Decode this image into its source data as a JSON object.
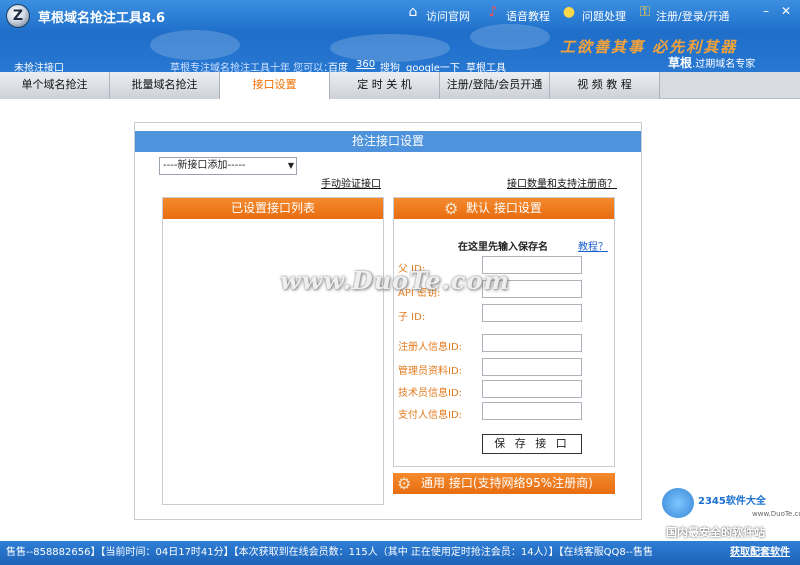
{
  "header": {
    "logo_glyph": "Z",
    "app_title": "草根域名抢注工具8.6",
    "links": {
      "visit_site": "访问官网",
      "voice_tutorial": "语音教程",
      "issue_handling": "问题处理",
      "register_login": "注册/登录/开通"
    },
    "min_glyph": "–",
    "close_glyph": "✕",
    "slogan": "工欲善其事 必先利其器",
    "brand_name": "草根",
    "brand_suffix": ".过期域名专家",
    "current_tab_label": "未抢注接口",
    "info_text": "草根专注域名抢注工具十年  您可以：",
    "search_links": [
      "百度",
      "360",
      "搜狗",
      "google一下",
      "草根工具"
    ]
  },
  "tabs": [
    {
      "label": "单个域名抢注"
    },
    {
      "label": "批量域名抢注"
    },
    {
      "label": "接口设置",
      "active": true
    },
    {
      "label": "定 时 关 机"
    },
    {
      "label": "注册/登陆/会员开通"
    },
    {
      "label": "视 频 教 程"
    }
  ],
  "panel": {
    "title": "抢注接口设置",
    "select_value": "----新接口添加-----",
    "manual_verify_link": "手动验证接口",
    "count_link": "接口数量和支持注册商？",
    "left_header": "已设置接口列表",
    "right_header": "默认 接口设置",
    "tip": "在这里先输入保存名",
    "tutorial_link": "教程？",
    "fields": [
      {
        "label": "父    ID:"
      },
      {
        "label": "API 密钥:"
      },
      {
        "label": "子    ID:"
      },
      {
        "label": "注册人信息ID:"
      },
      {
        "label": "管理员资料ID:"
      },
      {
        "label": "技术员信息ID:"
      },
      {
        "label": "支付人信息ID:"
      }
    ],
    "save_button": "保 存 接 口",
    "general_header": "通用 接口(支持网络95%注册商)"
  },
  "watermark": {
    "main": "www.DuoTe.com",
    "corner_site": "2345软件大全",
    "corner_url": "www.DuoTe.com",
    "corner_slogan": "国内最安全的软件站"
  },
  "status": {
    "text": "售售--858882656】【当前时间：04日17时41分】【本次获取到在线会员数：115人（其中 正在使用定时抢注会员：14人）】【在线客服QQ8--售售",
    "get_link": "获取配套软件"
  },
  "colors": {
    "header_blue": "#1f6fca",
    "tab_active_text": "#f26d00",
    "orange": "#e86d10",
    "panel_title_blue": "#4e93dc"
  }
}
